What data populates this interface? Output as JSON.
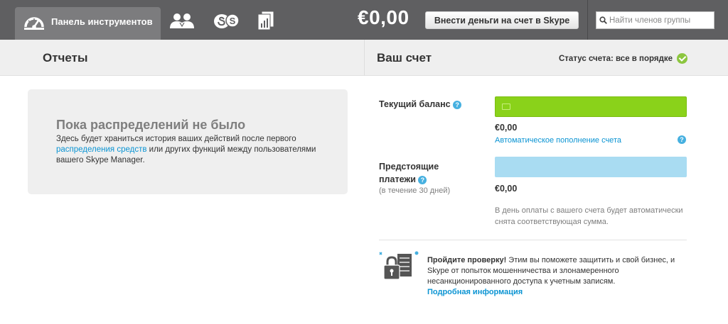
{
  "topbar": {
    "dashboard_label": "Панель инструментов",
    "balance": "€0,00",
    "topup_label": "Внести деньги на счет в Skype",
    "search_placeholder": "Найти членов группы",
    "icons": [
      "dashboard-gauge-icon",
      "users-icon",
      "skype-credit-icon",
      "reports-icon",
      "search-icon"
    ]
  },
  "reports": {
    "title": "Отчеты",
    "empty_title": "Пока распределений не было",
    "empty_text_1": "Здесь будет храниться история ваших действий после первого ",
    "empty_link": "распределения средств",
    "empty_text_2": " или других функций между пользователями вашего Skype Manager."
  },
  "account": {
    "title": "Ваш счет",
    "status": "Статус счета: все в порядке",
    "current_balance_label": "Текущий баланс",
    "current_balance": "€0,00",
    "auto_topup_link": "Автоматическое пополнение счета",
    "upcoming_label_1": "Предстоящие",
    "upcoming_label_2": "платежи",
    "upcoming_period": "(в течение 30 дней)",
    "upcoming_amount": "€0,00",
    "upcoming_note": "В день оплаты с вашего счета будет автоматически снята соответствующая сумма.",
    "verify_bold": "Пройдите проверку!",
    "verify_text": " Этим вы поможете защитить и свой бизнес, и Skype от попыток мошенничества и злонамеренного несанкционированного доступа к учетным записям.",
    "verify_link": "Подробная информация",
    "help_glyph": "?"
  },
  "colors": {
    "topbar": "#5f5f61",
    "active_tab": "#7c7c7e",
    "link": "#0b94d3",
    "balance_bar": "#8ad21a",
    "upcoming_bar": "#a9dcf2",
    "status_ok": "#8cc63f"
  }
}
